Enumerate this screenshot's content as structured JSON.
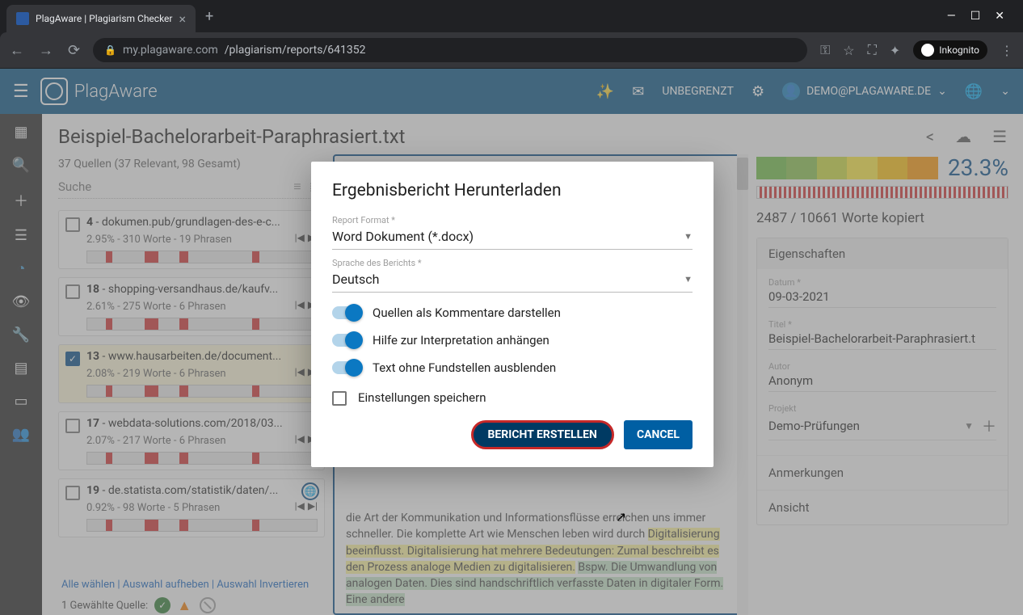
{
  "browser": {
    "tab_title": "PlagAware | Plagiarism Checker",
    "url_host": "my.plagaware.com",
    "url_path": "/plagiarism/reports/641352",
    "inkognito": "Inkognito"
  },
  "header": {
    "logo": "PlagAware",
    "plan": "UNBEGRENZT",
    "user": "DEMO@PLAGAWARE.DE"
  },
  "page": {
    "title": "Beispiel-Bachelorarbeit-Paraphrasiert.txt"
  },
  "sources": {
    "summary": "37 Quellen (37 Relevant, 98 Gesamt)",
    "search_placeholder": "Suche",
    "items": [
      {
        "idx": "4",
        "url": "dokumen.pub/grundlagen-des-e-c...",
        "meta": "2.95% - 310 Worte - 19 Phrasen",
        "checked": false
      },
      {
        "idx": "18",
        "url": "shopping-versandhaus.de/kaufv...",
        "meta": "2.61% - 275 Worte - 6 Phrasen",
        "checked": false
      },
      {
        "idx": "13",
        "url": "www.hausarbeiten.de/document...",
        "meta": "2.08% - 219 Worte - 6 Phrasen",
        "checked": true
      },
      {
        "idx": "17",
        "url": "webdata-solutions.com/2018/03...",
        "meta": "2.07% - 217 Worte - 6 Phrasen",
        "checked": false
      },
      {
        "idx": "19",
        "url": "de.statista.com/statistik/daten/...",
        "meta": "0.92% - 98 Worte - 5 Phrasen",
        "checked": false,
        "globe": true
      }
    ],
    "footer_all": "Alle wählen",
    "footer_none": "Auswahl aufheben",
    "footer_invert": "Auswahl Invertieren",
    "selected_label": "1 Gewählte Quelle:"
  },
  "text_body": "die Art der Kommunikation und Informationsflüsse erreichen uns immer schneller. Die komplette Art wie Menschen leben wird durch Digitalisierung beeinflusst. Digitalisierung hat mehrere Bedeutungen: Zumal beschreibt es den Prozess analoge Medien zu digitalisieren. Bspw. Die Umwandlung von analogen Daten. Dies sind handschriftlich verfasste Daten in digitaler Form. Eine andere",
  "right": {
    "percent": "23.3%",
    "words": "2487 / 10661 Worte kopiert",
    "props_title": "Eigenschaften",
    "date_label": "Datum *",
    "date_value": "09-03-2021",
    "title_label": "Titel *",
    "title_value": "Beispiel-Bachelorarbeit-Paraphrasiert.t",
    "author_label": "Autor",
    "author_value": "Anonym",
    "project_label": "Projekt",
    "project_value": "Demo-Prüfungen",
    "notes": "Anmerkungen",
    "view": "Ansicht"
  },
  "modal": {
    "title": "Ergebnisbericht Herunterladen",
    "format_label": "Report Format *",
    "format_value": "Word Dokument (*.docx)",
    "lang_label": "Sprache des Berichts *",
    "lang_value": "Deutsch",
    "opt1": "Quellen als Kommentare darstellen",
    "opt2": "Hilfe zur Interpretation anhängen",
    "opt3": "Text ohne Fundstellen ausblenden",
    "save": "Einstellungen speichern",
    "create": "BERICHT ERSTELLEN",
    "cancel": "CANCEL"
  }
}
